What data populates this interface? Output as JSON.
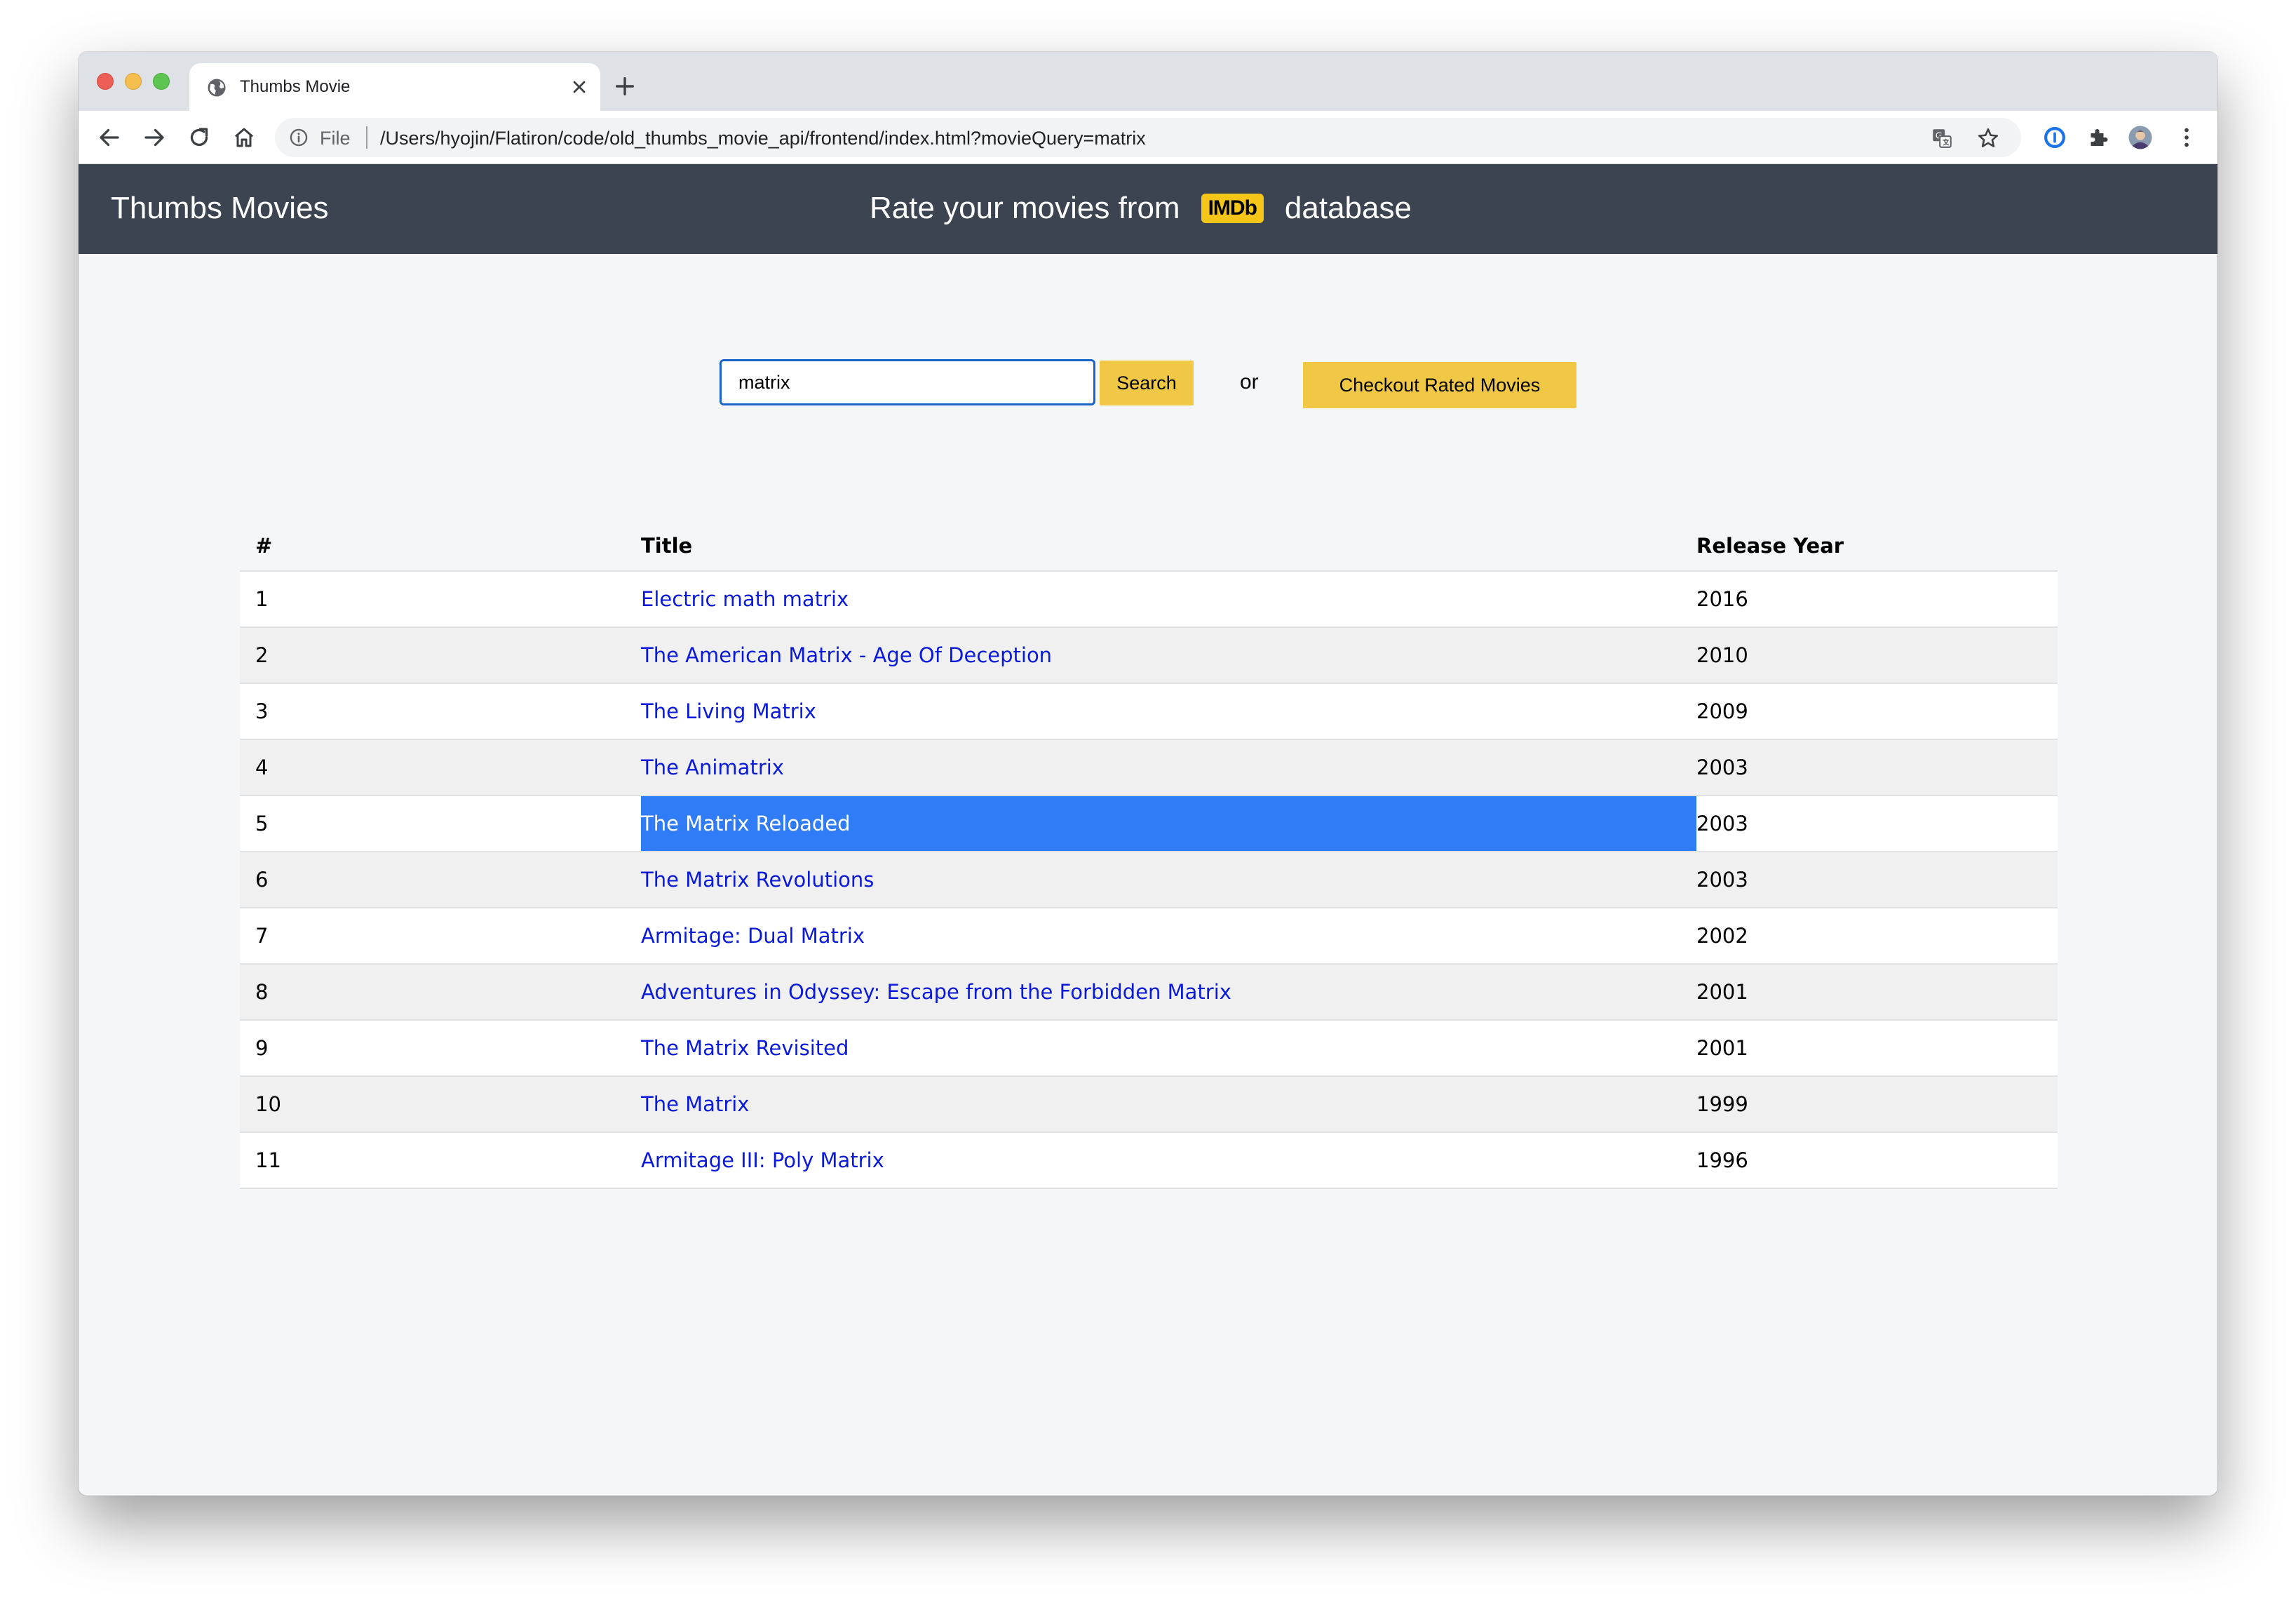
{
  "browser": {
    "tab_title": "Thumbs Movie",
    "address_scheme_label": "File",
    "url": "/Users/hyojin/Flatiron/code/old_thumbs_movie_api/frontend/index.html?movieQuery=matrix"
  },
  "header": {
    "brand": "Thumbs Movies",
    "tagline_before": "Rate your movies from",
    "imdb_logo": "IMDb",
    "tagline_after": "database"
  },
  "search": {
    "value": "matrix",
    "button_label": "Search",
    "or_label": "or",
    "rated_button_label": "Checkout Rated Movies"
  },
  "table": {
    "headers": [
      "#",
      "Title",
      "Release Year"
    ],
    "rows": [
      {
        "num": "1",
        "title": "Electric math matrix",
        "year": "2016"
      },
      {
        "num": "2",
        "title": "The American Matrix - Age Of Deception",
        "year": "2010"
      },
      {
        "num": "3",
        "title": "The Living Matrix",
        "year": "2009"
      },
      {
        "num": "4",
        "title": "The Animatrix",
        "year": "2003"
      },
      {
        "num": "5",
        "title": "The Matrix Reloaded",
        "year": "2003",
        "selected": true
      },
      {
        "num": "6",
        "title": "The Matrix Revolutions",
        "year": "2003"
      },
      {
        "num": "7",
        "title": "Armitage: Dual Matrix",
        "year": "2002"
      },
      {
        "num": "8",
        "title": "Adventures in Odyssey: Escape from the Forbidden Matrix",
        "year": "2001"
      },
      {
        "num": "9",
        "title": "The Matrix Revisited",
        "year": "2001"
      },
      {
        "num": "10",
        "title": "The Matrix",
        "year": "1999"
      },
      {
        "num": "11",
        "title": "Armitage III: Poly Matrix",
        "year": "1996"
      }
    ]
  },
  "colors": {
    "header_bg": "#3d4451",
    "accent_yellow": "#f0c846",
    "link_blue": "#0a1ad8",
    "selection_blue": "#2f7cf6"
  }
}
